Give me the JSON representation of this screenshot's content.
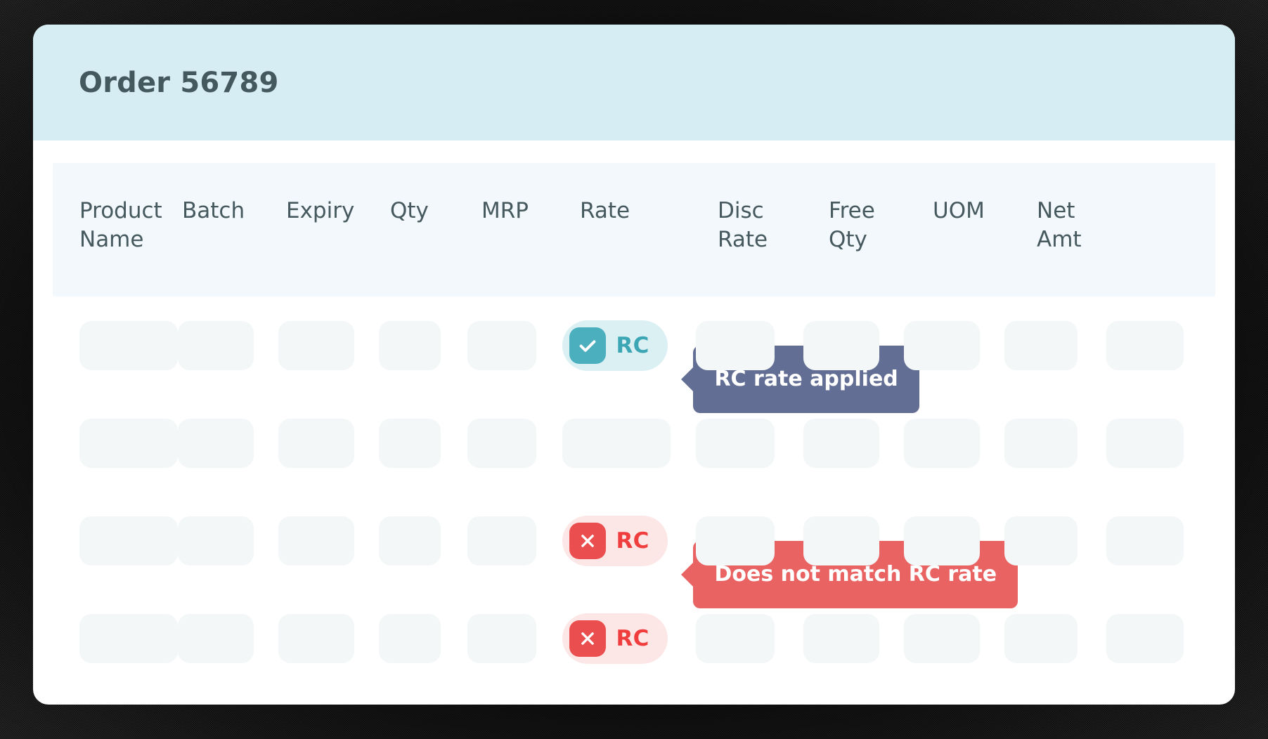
{
  "card": {
    "title": "Order 56789"
  },
  "table": {
    "columns": [
      {
        "id": "product-name",
        "lines": [
          "Product",
          "Name"
        ]
      },
      {
        "id": "batch",
        "lines": [
          "Batch"
        ]
      },
      {
        "id": "expiry",
        "lines": [
          "Expiry"
        ]
      },
      {
        "id": "qty",
        "lines": [
          "Qty"
        ]
      },
      {
        "id": "mrp",
        "lines": [
          "MRP"
        ]
      },
      {
        "id": "rate",
        "lines": [
          "Rate"
        ]
      },
      {
        "id": "disc-rate",
        "lines": [
          "Disc",
          "Rate"
        ]
      },
      {
        "id": "free-qty",
        "lines": [
          "Free",
          "Qty"
        ]
      },
      {
        "id": "uom",
        "lines": [
          "UOM"
        ]
      },
      {
        "id": "net-amt",
        "lines": [
          "Net",
          "Amt"
        ]
      }
    ],
    "column_count": 11,
    "rows": [
      {
        "index": 1,
        "rate_status": {
          "type": "ok",
          "label": "RC",
          "icon": "check-icon"
        },
        "tooltip": {
          "text": "RC rate applied",
          "variant": "neutral"
        }
      },
      {
        "index": 2,
        "rate_status": null,
        "tooltip": null
      },
      {
        "index": 3,
        "rate_status": {
          "type": "bad",
          "label": "RC",
          "icon": "close-icon"
        },
        "tooltip": {
          "text": "Does not match RC rate",
          "variant": "danger"
        }
      },
      {
        "index": 4,
        "rate_status": {
          "type": "bad",
          "label": "RC",
          "icon": "close-icon"
        },
        "tooltip": null
      }
    ]
  },
  "colors": {
    "title_band": "#d6edf3",
    "title_text": "#44595e",
    "table_header_bg": "#f2f8fb",
    "header_text": "#45595e",
    "skeleton": "#f3f7f8",
    "rc_ok_pill": "#dbf0f3",
    "rc_ok_icon": "#4cafbd",
    "rc_ok_text": "#3da6b5",
    "rc_bad_pill": "#fde6e6",
    "rc_bad_icon": "#ea4e4e",
    "rc_bad_text": "#f03e3e",
    "tooltip_neutral": "#636e94",
    "tooltip_danger": "#ea6363",
    "card_bg": "#ffffff",
    "frame_bg": "#000000"
  }
}
